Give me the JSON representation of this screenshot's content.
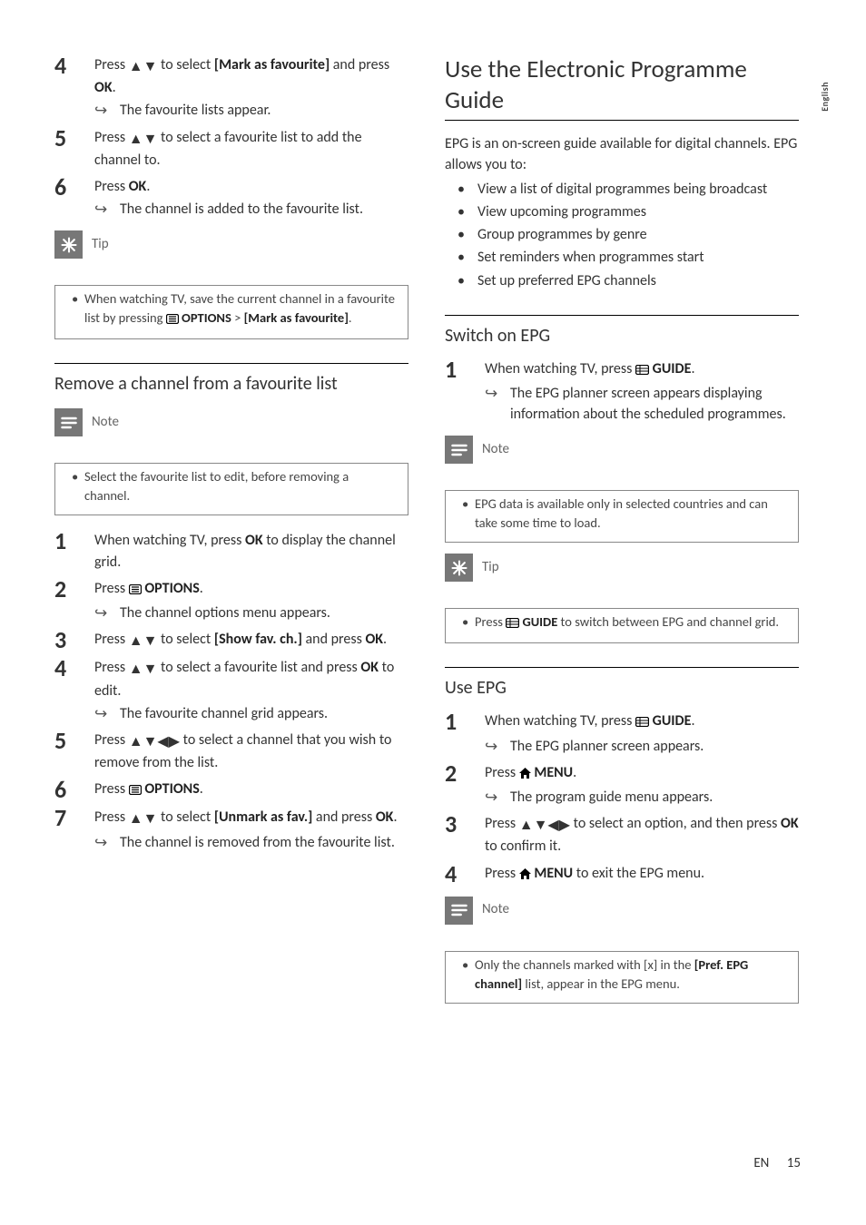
{
  "sideTab": "English",
  "left": {
    "stepsA": [
      {
        "n": "4",
        "body_pre": "Press ",
        "body_mid": " to select ",
        "bold1": "[Mark as favourite]",
        "body_post": " and press ",
        "bold2": "OK",
        "tail": ".",
        "result": "The favourite lists appear."
      },
      {
        "n": "5",
        "body_pre": "Press ",
        "body_mid": " to select a favourite list to add the channel to.",
        "bold1": "",
        "body_post": "",
        "bold2": "",
        "tail": ""
      },
      {
        "n": "6",
        "body_pre": "Press ",
        "bold2": "OK",
        "tail": ".",
        "result": "The channel is added to the favourite list."
      }
    ],
    "tip1_label": "Tip",
    "tip1_a": "When watching TV, save the current channel in a favourite list by pressing ",
    "tip1_opt": " OPTIONS",
    "tip1_b": " > ",
    "tip1_c": "[Mark as favourite]",
    "tip1_d": ".",
    "h2a": "Remove a channel from a favourite list",
    "note1_label": "Note",
    "note1_text": "Select the favourite list to edit, before removing a channel.",
    "stepsB": [
      {
        "n": "1",
        "pre": "When watching TV, press ",
        "b1": "OK",
        "post": " to display the channel grid."
      },
      {
        "n": "2",
        "pre": "Press ",
        "icon": "options",
        "b1": " OPTIONS",
        "post": ".",
        "result": "The channel options menu appears."
      },
      {
        "n": "3",
        "pre": "Press ",
        "nav": "ud",
        "mid": " to select ",
        "b1": "[Show fav. ch.]",
        "post2": " and press ",
        "b2": "OK",
        "post": "."
      },
      {
        "n": "4",
        "pre": "Press ",
        "nav": "ud",
        "mid": " to select a favourite list and press ",
        "b1": "OK",
        "post": " to edit.",
        "result": "The favourite channel grid appears."
      },
      {
        "n": "5",
        "pre": "Press ",
        "nav": "udlr",
        "mid": " to select a channel that you wish to remove from the list.",
        "post": ""
      },
      {
        "n": "6",
        "pre": "Press ",
        "icon": "options",
        "b1": " OPTIONS",
        "post": "."
      },
      {
        "n": "7",
        "pre": "Press ",
        "nav": "ud",
        "mid": " to select ",
        "b1": "[Unmark as fav.]",
        "post2": " and press ",
        "b2": "OK",
        "post": ".",
        "result": "The channel is removed from the favourite list."
      }
    ]
  },
  "right": {
    "h1": "Use the Electronic Programme Guide",
    "intro": "EPG is an on-screen guide available for digital channels. EPG allows you to:",
    "bullets": [
      "View a list of digital programmes being broadcast",
      "View upcoming programmes",
      "Group programmes by genre",
      "Set reminders when programmes start",
      "Set up preferred EPG channels"
    ],
    "h2a": "Switch on EPG",
    "step_r1_pre": "When watching TV, press ",
    "step_r1_b": " GUIDE",
    "step_r1_post": ".",
    "step_r1_result": "The EPG planner screen appears displaying information about the scheduled programmes.",
    "note2_label": "Note",
    "note2_text": "EPG data is available only in selected countries and can take some time to load.",
    "tip2_label": "Tip",
    "tip2_pre": "Press ",
    "tip2_b": " GUIDE",
    "tip2_post": " to switch between EPG and channel grid.",
    "h2b": "Use EPG",
    "stepsR2": [
      {
        "n": "1",
        "pre": "When watching TV, press ",
        "icon": "guide",
        "b1": " GUIDE",
        "post": ".",
        "result": "The EPG planner screen appears."
      },
      {
        "n": "2",
        "pre": "Press ",
        "icon": "home",
        "b1": " MENU",
        "post": ".",
        "result": "The program guide menu appears."
      },
      {
        "n": "3",
        "pre": "Press ",
        "nav": "udlr",
        "mid": " to select an option, and then press ",
        "b1": "OK",
        "post": " to confirm it."
      },
      {
        "n": "4",
        "pre": "Press ",
        "icon": "home",
        "b1": " MENU",
        "post": " to exit the EPG menu."
      }
    ],
    "note3_label": "Note",
    "note3_pre": "Only the channels marked with [x] in the ",
    "note3_b": "[Pref. EPG channel]",
    "note3_post": " list, appear in the EPG menu."
  },
  "footer": {
    "lang": "EN",
    "page": "15"
  }
}
